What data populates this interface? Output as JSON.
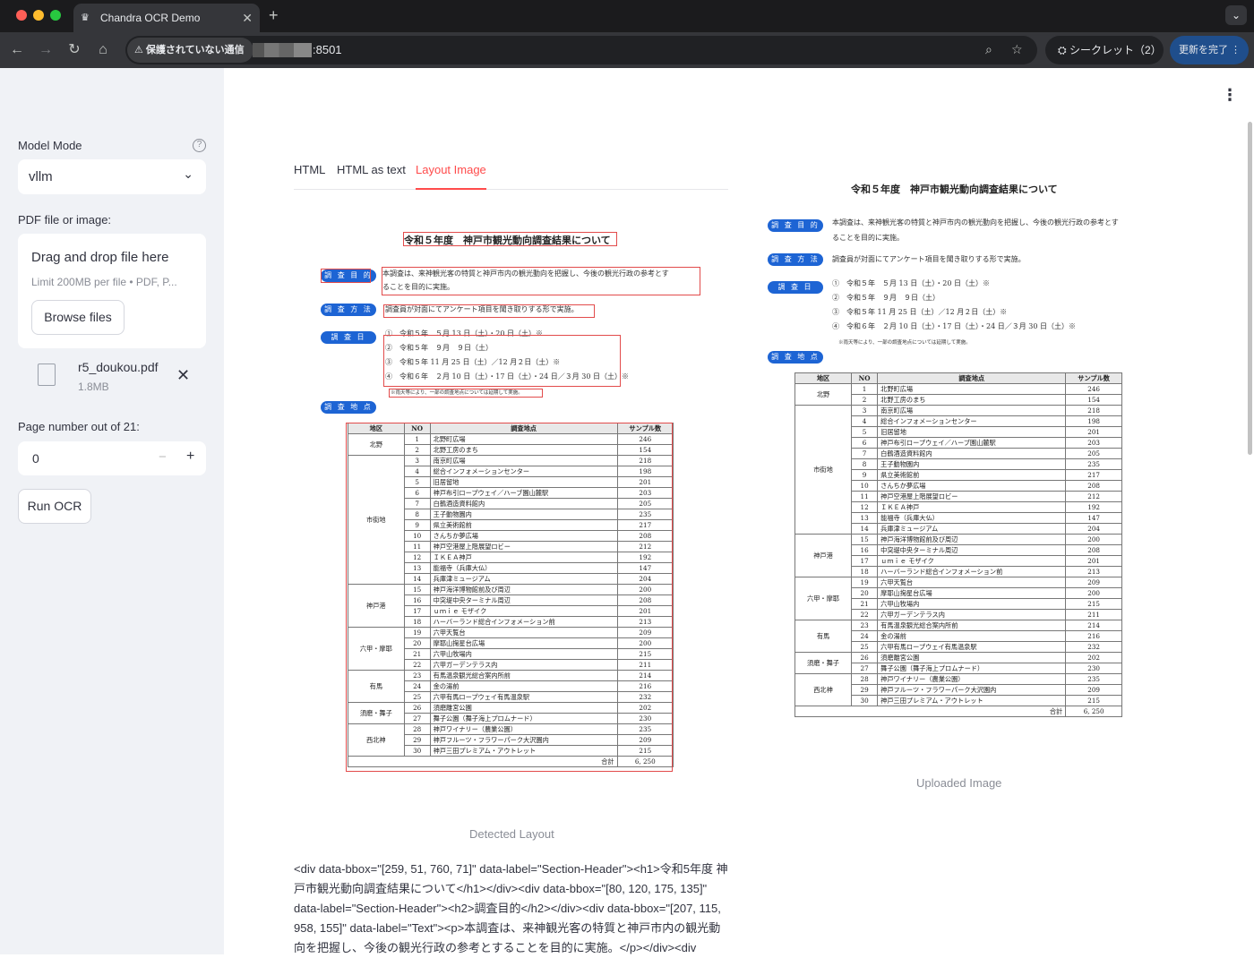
{
  "browser": {
    "tab_title": "Chandra OCR Demo",
    "url": ":8501",
    "security": "保護されていない通信",
    "incognito": "シークレット（2）",
    "update": "更新を完了"
  },
  "sidebar": {
    "model_mode_label": "Model Mode",
    "model_mode_value": "vllm",
    "file_label": "PDF file or image:",
    "drop_title": "Drag and drop file here",
    "drop_limit": "Limit 200MB per file • PDF, P...",
    "browse": "Browse files",
    "file_name": "r5_doukou.pdf",
    "file_size": "1.8MB",
    "page_label": "Page number out of 21:",
    "page_value": "0",
    "run": "Run OCR"
  },
  "tabs": [
    "HTML",
    "HTML as text",
    "Layout Image"
  ],
  "doc": {
    "title": "令和５年度　神戸市観光動向調査結果について",
    "pills": [
      "調 査 目 的",
      "調 査 方 法",
      "調 査 日",
      "調 査 地 点"
    ],
    "purpose_l1": "本調査は、来神観光客の特質と神戸市内の観光動向を把握し、今後の観光行政の参考とす",
    "purpose_l2": "ることを目的に実施。",
    "method": "調査員が対面にてアンケート項目を聞き取りする形で実施。",
    "dates": [
      "①　令和５年　５月 13 日（土）・20 日（土）※",
      "②　令和５年　９月　９日（土）",
      "③　令和５年 11 月 25 日（土）／12 月２日（土）※",
      "④　令和６年　２月 10 日（土）・17 日（土）・24 日／３月 30 日（土）※"
    ],
    "note": "※雨天等により、一部の調査地点については延期して実施。",
    "headers": [
      "地区",
      "NO",
      "調査地点",
      "サンプル数"
    ],
    "rows": [
      [
        "北野",
        "1",
        "北野町広場",
        "246"
      ],
      [
        "",
        "2",
        "北野工房のまち",
        "154"
      ],
      [
        "市街地",
        "3",
        "南京町広場",
        "218"
      ],
      [
        "",
        "4",
        "総合インフォメーションセンター",
        "198"
      ],
      [
        "",
        "5",
        "旧居留地",
        "201"
      ],
      [
        "",
        "6",
        "神戸布引ロープウェイ／ハーブ園山麓駅",
        "203"
      ],
      [
        "",
        "7",
        "白鶴酒造資料館内",
        "205"
      ],
      [
        "",
        "8",
        "王子動物園内",
        "235"
      ],
      [
        "",
        "9",
        "県立美術館前",
        "217"
      ],
      [
        "",
        "10",
        "さんちか夢広場",
        "208"
      ],
      [
        "",
        "11",
        "神戸空港屋上階展望ロビー",
        "212"
      ],
      [
        "",
        "12",
        "ＩＫＥＡ神戸",
        "192"
      ],
      [
        "",
        "13",
        "能福寺（兵庫大仏）",
        "147"
      ],
      [
        "",
        "14",
        "兵庫津ミュージアム",
        "204"
      ],
      [
        "神戸港",
        "15",
        "神戸海洋博物館前及び周辺",
        "200"
      ],
      [
        "",
        "16",
        "中突堤中央ターミナル周辺",
        "208"
      ],
      [
        "",
        "17",
        "ｕｍｉｅ モザイク",
        "201"
      ],
      [
        "",
        "18",
        "ハーバーランド総合インフォメーション前",
        "213"
      ],
      [
        "六甲・摩耶",
        "19",
        "六甲天覧台",
        "209"
      ],
      [
        "",
        "20",
        "摩耶山掬星台広場",
        "200"
      ],
      [
        "",
        "21",
        "六甲山牧場内",
        "215"
      ],
      [
        "",
        "22",
        "六甲ガーデンテラス内",
        "211"
      ],
      [
        "有馬",
        "23",
        "有馬温泉観光総合案内所前",
        "214"
      ],
      [
        "",
        "24",
        "金の湯前",
        "216"
      ],
      [
        "",
        "25",
        "六甲有馬ロープウェイ有馬温泉駅",
        "232"
      ],
      [
        "須磨・舞子",
        "26",
        "須磨離宮公園",
        "202"
      ],
      [
        "",
        "27",
        "舞子公園（舞子海上プロムナード）",
        "230"
      ],
      [
        "西北神",
        "28",
        "神戸ワイナリー（農業公園）",
        "235"
      ],
      [
        "",
        "29",
        "神戸フルーツ・フラワーパーク大沢園内",
        "209"
      ],
      [
        "",
        "30",
        "神戸三田プレミアム・アウトレット",
        "215"
      ]
    ],
    "total_label": "合計",
    "total_value": "6, 250"
  },
  "captions": {
    "left": "Detected Layout",
    "right": "Uploaded Image"
  },
  "code_text": "<div data-bbox=\"[259, 51, 760, 71]\" data-label=\"Section-Header\"><h1>令和5年度 神戸市観光動向調査結果について</h1></div><div data-bbox=\"[80, 120, 175, 135]\" data-label=\"Section-Header\"><h2>調査目的</h2></div><div data-bbox=\"[207, 115, 958, 155]\" data-label=\"Text\"><p>本調査は、来神観光客の特質と神戸市内の観光動向を把握し、今後の観光行政の参考とすることを目的に実施。</p></div><div"
}
